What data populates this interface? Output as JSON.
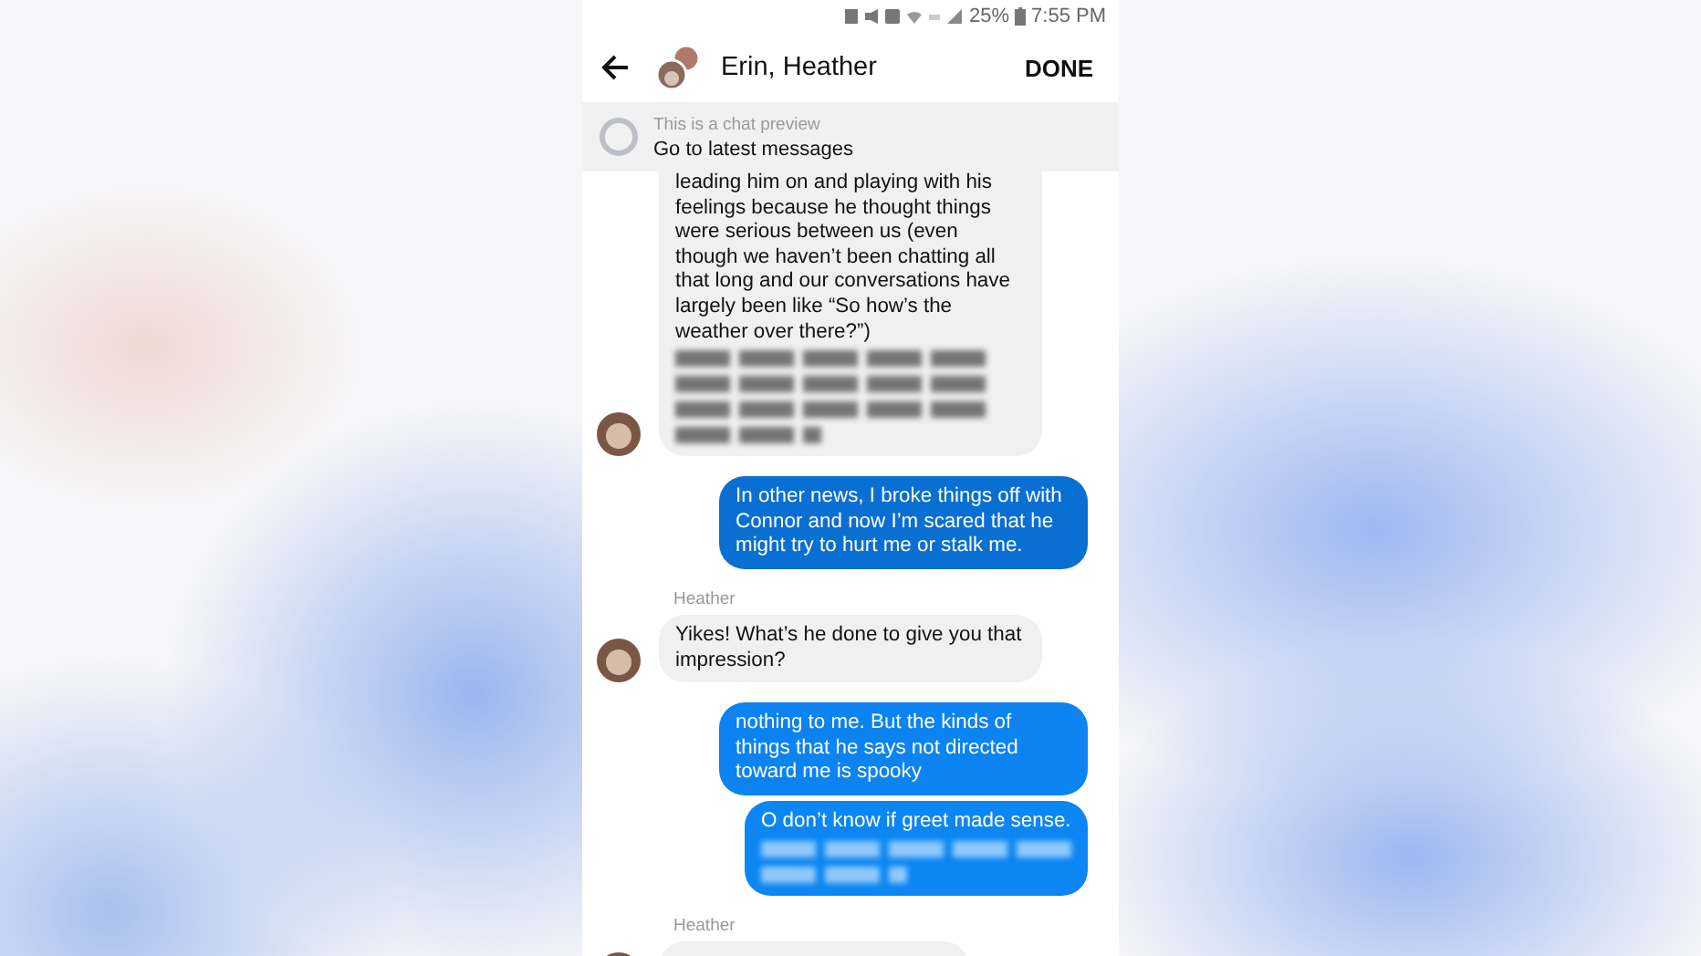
{
  "status_bar": {
    "battery": "25%",
    "time": "7:55 PM"
  },
  "header": {
    "title": "Erin, Heather",
    "action": "DONE"
  },
  "preview_banner": {
    "caption": "This is a chat preview",
    "link": "Go to latest messages"
  },
  "messages": [
    {
      "kind": "incoming",
      "text": "leading him on and playing with his feelings because he thought things were serious between us (even though we haven’t been chatting all that long and our conversations have largely been like “So how’s the weather over there?”)",
      "redacted": true,
      "cut": true
    },
    {
      "kind": "outgoing",
      "color": "#0a6fd3",
      "text": "In other news, I broke things off with Connor and now I’m scared that he might try to hurt me or stalk me."
    },
    {
      "kind": "incoming",
      "sender": "Heather",
      "text": "Yikes! What’s he done to give you that impression?"
    },
    {
      "kind": "outgoing",
      "color": "#0b83f0",
      "text": "nothing to me. But the kinds of things that he says not directed toward me is spooky"
    },
    {
      "kind": "outgoing",
      "color": "#0b86f3",
      "text": "O don’t know if greet made sense.",
      "redacted": true
    },
    {
      "kind": "incoming",
      "sender": "Heather"
    }
  ]
}
